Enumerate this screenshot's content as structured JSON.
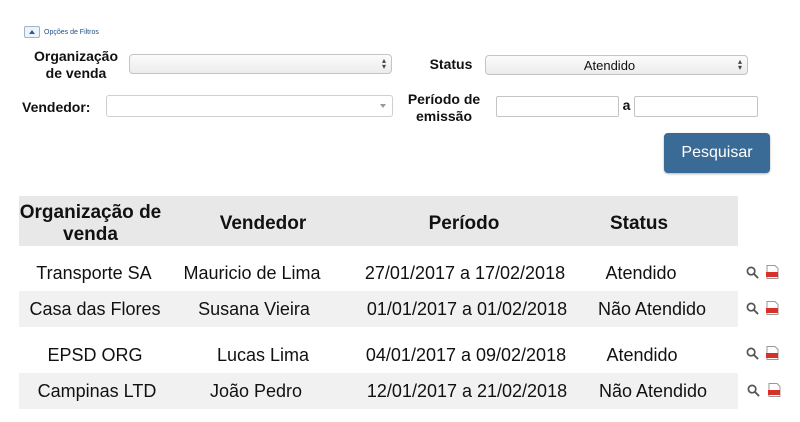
{
  "filters": {
    "toggle_label": "Opções de Filtros",
    "org_label": "Organização de venda",
    "org_value": "",
    "status_label": "Status",
    "status_value": "Atendido",
    "vendedor_label": "Vendedor:",
    "vendedor_value": "",
    "periodo_label": "Período de emissão",
    "periodo_start": "",
    "periodo_sep": "a",
    "periodo_end": "",
    "search_button": "Pesquisar"
  },
  "table": {
    "headers": [
      "Organização de venda",
      "Vendedor",
      "Período",
      "Status"
    ],
    "rows": [
      {
        "org": "Transporte SA",
        "vendedor": "Mauricio de Lima",
        "periodo": "27/01/2017 a 17/02/2018",
        "status": "Atendido"
      },
      {
        "org": "Casa das Flores",
        "vendedor": "Susana Vieira",
        "periodo": "01/01/2017 a 01/02/2018",
        "status": "Não Atendido"
      },
      {
        "org": "EPSD ORG",
        "vendedor": "Lucas Lima",
        "periodo": "04/01/2017 a 09/02/2018",
        "status": "Atendido"
      },
      {
        "org": "Campinas LTD",
        "vendedor": "João Pedro",
        "periodo": "12/01/2017 a 21/02/2018",
        "status": "Não Atendido"
      }
    ]
  },
  "icons": {
    "view": "search-icon",
    "pdf": "pdf-icon"
  },
  "colors": {
    "button": "#3a6b96",
    "header_bg": "#e8e8e8",
    "alt_row": "#f1f1f1",
    "pdf_red": "#d9302c"
  }
}
